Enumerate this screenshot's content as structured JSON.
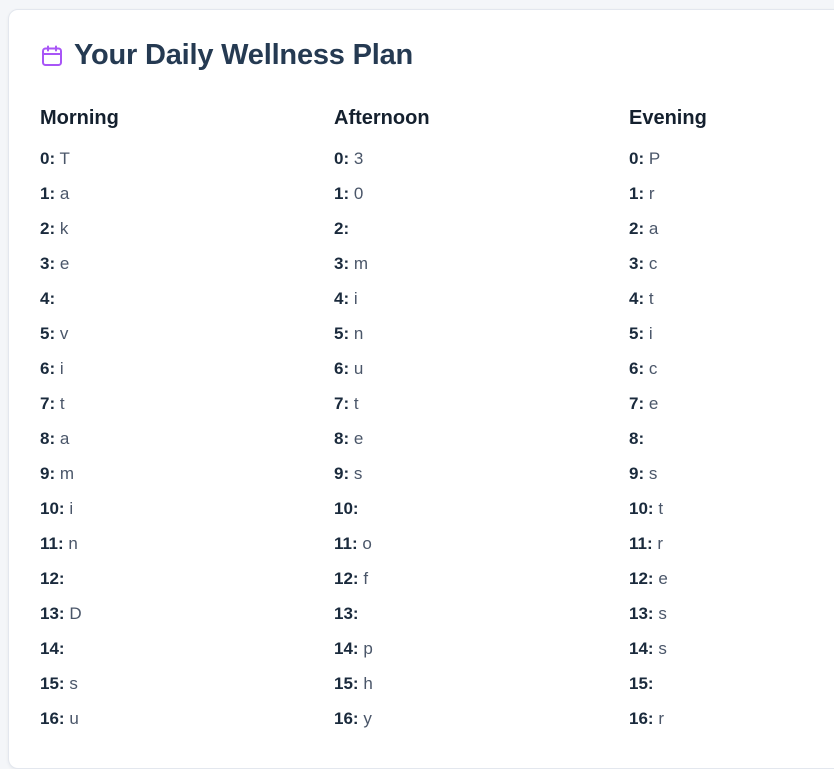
{
  "header": {
    "title": "Your Daily Wellness Plan",
    "icon": "calendar-icon",
    "accent_color": "#a855f7"
  },
  "columns": [
    {
      "key": "morning",
      "heading": "Morning",
      "items": [
        {
          "index": "0:",
          "value": "T"
        },
        {
          "index": "1:",
          "value": "a"
        },
        {
          "index": "2:",
          "value": "k"
        },
        {
          "index": "3:",
          "value": "e"
        },
        {
          "index": "4:",
          "value": ""
        },
        {
          "index": "5:",
          "value": "v"
        },
        {
          "index": "6:",
          "value": "i"
        },
        {
          "index": "7:",
          "value": "t"
        },
        {
          "index": "8:",
          "value": "a"
        },
        {
          "index": "9:",
          "value": "m"
        },
        {
          "index": "10:",
          "value": "i"
        },
        {
          "index": "11:",
          "value": "n"
        },
        {
          "index": "12:",
          "value": ""
        },
        {
          "index": "13:",
          "value": "D"
        },
        {
          "index": "14:",
          "value": ""
        },
        {
          "index": "15:",
          "value": "s"
        },
        {
          "index": "16:",
          "value": "u"
        }
      ]
    },
    {
      "key": "afternoon",
      "heading": "Afternoon",
      "items": [
        {
          "index": "0:",
          "value": "3"
        },
        {
          "index": "1:",
          "value": "0"
        },
        {
          "index": "2:",
          "value": ""
        },
        {
          "index": "3:",
          "value": "m"
        },
        {
          "index": "4:",
          "value": "i"
        },
        {
          "index": "5:",
          "value": "n"
        },
        {
          "index": "6:",
          "value": "u"
        },
        {
          "index": "7:",
          "value": "t"
        },
        {
          "index": "8:",
          "value": "e"
        },
        {
          "index": "9:",
          "value": "s"
        },
        {
          "index": "10:",
          "value": ""
        },
        {
          "index": "11:",
          "value": "o"
        },
        {
          "index": "12:",
          "value": "f"
        },
        {
          "index": "13:",
          "value": ""
        },
        {
          "index": "14:",
          "value": "p"
        },
        {
          "index": "15:",
          "value": "h"
        },
        {
          "index": "16:",
          "value": "y"
        }
      ]
    },
    {
      "key": "evening",
      "heading": "Evening",
      "items": [
        {
          "index": "0:",
          "value": "P"
        },
        {
          "index": "1:",
          "value": "r"
        },
        {
          "index": "2:",
          "value": "a"
        },
        {
          "index": "3:",
          "value": "c"
        },
        {
          "index": "4:",
          "value": "t"
        },
        {
          "index": "5:",
          "value": "i"
        },
        {
          "index": "6:",
          "value": "c"
        },
        {
          "index": "7:",
          "value": "e"
        },
        {
          "index": "8:",
          "value": ""
        },
        {
          "index": "9:",
          "value": "s"
        },
        {
          "index": "10:",
          "value": "t"
        },
        {
          "index": "11:",
          "value": "r"
        },
        {
          "index": "12:",
          "value": "e"
        },
        {
          "index": "13:",
          "value": "s"
        },
        {
          "index": "14:",
          "value": "s"
        },
        {
          "index": "15:",
          "value": ""
        },
        {
          "index": "16:",
          "value": "r"
        }
      ]
    }
  ]
}
